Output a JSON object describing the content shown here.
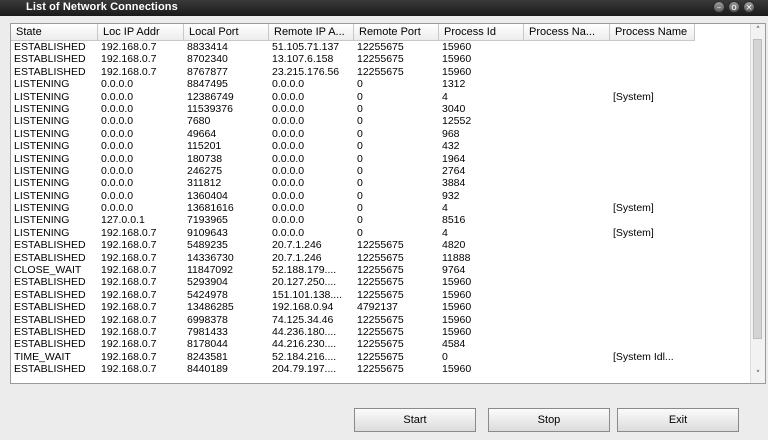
{
  "window": {
    "title": "List of Network Connections",
    "controls": {
      "minimize": "–",
      "restore": "o",
      "close": "×"
    }
  },
  "table": {
    "columns": [
      "State",
      "Loc IP Addr",
      "Local Port",
      "Remote IP A...",
      "Remote Port",
      "Process Id",
      "Process Na...",
      "Process Name"
    ],
    "rows": [
      [
        "ESTABLISHED",
        "192.168.0.7",
        "8833414",
        "51.105.71.137",
        "12255675",
        "15960",
        "",
        ""
      ],
      [
        "ESTABLISHED",
        "192.168.0.7",
        "8702340",
        "13.107.6.158",
        "12255675",
        "15960",
        "",
        ""
      ],
      [
        "ESTABLISHED",
        "192.168.0.7",
        "8767877",
        "23.215.176.56",
        "12255675",
        "15960",
        "",
        ""
      ],
      [
        "LISTENING",
        "0.0.0.0",
        "8847495",
        "0.0.0.0",
        "0",
        "1312",
        "",
        ""
      ],
      [
        "LISTENING",
        "0.0.0.0",
        "12386749",
        "0.0.0.0",
        "0",
        "4",
        "",
        "[System]"
      ],
      [
        "LISTENING",
        "0.0.0.0",
        "11539376",
        "0.0.0.0",
        "0",
        "3040",
        "",
        ""
      ],
      [
        "LISTENING",
        "0.0.0.0",
        "7680",
        "0.0.0.0",
        "0",
        "12552",
        "",
        ""
      ],
      [
        "LISTENING",
        "0.0.0.0",
        "49664",
        "0.0.0.0",
        "0",
        "968",
        "",
        ""
      ],
      [
        "LISTENING",
        "0.0.0.0",
        "115201",
        "0.0.0.0",
        "0",
        "432",
        "",
        ""
      ],
      [
        "LISTENING",
        "0.0.0.0",
        "180738",
        "0.0.0.0",
        "0",
        "1964",
        "",
        ""
      ],
      [
        "LISTENING",
        "0.0.0.0",
        "246275",
        "0.0.0.0",
        "0",
        "2764",
        "",
        ""
      ],
      [
        "LISTENING",
        "0.0.0.0",
        "311812",
        "0.0.0.0",
        "0",
        "3884",
        "",
        ""
      ],
      [
        "LISTENING",
        "0.0.0.0",
        "1360404",
        "0.0.0.0",
        "0",
        "932",
        "",
        ""
      ],
      [
        "LISTENING",
        "0.0.0.0",
        "13681616",
        "0.0.0.0",
        "0",
        "4",
        "",
        "[System]"
      ],
      [
        "LISTENING",
        "127.0.0.1",
        "7193965",
        "0.0.0.0",
        "0",
        "8516",
        "",
        ""
      ],
      [
        "LISTENING",
        "192.168.0.7",
        "9109643",
        "0.0.0.0",
        "0",
        "4",
        "",
        "[System]"
      ],
      [
        "ESTABLISHED",
        "192.168.0.7",
        "5489235",
        "20.7.1.246",
        "12255675",
        "4820",
        "",
        ""
      ],
      [
        "ESTABLISHED",
        "192.168.0.7",
        "14336730",
        "20.7.1.246",
        "12255675",
        "11888",
        "",
        ""
      ],
      [
        "CLOSE_WAIT",
        "192.168.0.7",
        "11847092",
        "52.188.179....",
        "12255675",
        "9764",
        "",
        ""
      ],
      [
        "ESTABLISHED",
        "192.168.0.7",
        "5293904",
        "20.127.250....",
        "12255675",
        "15960",
        "",
        ""
      ],
      [
        "ESTABLISHED",
        "192.168.0.7",
        "5424978",
        "151.101.138....",
        "12255675",
        "15960",
        "",
        ""
      ],
      [
        "ESTABLISHED",
        "192.168.0.7",
        "13486285",
        "192.168.0.94",
        "4792137",
        "15960",
        "",
        ""
      ],
      [
        "ESTABLISHED",
        "192.168.0.7",
        "6998378",
        "74.125.34.46",
        "12255675",
        "15960",
        "",
        ""
      ],
      [
        "ESTABLISHED",
        "192.168.0.7",
        "7981433",
        "44.236.180....",
        "12255675",
        "15960",
        "",
        ""
      ],
      [
        "ESTABLISHED",
        "192.168.0.7",
        "8178044",
        "44.216.230....",
        "12255675",
        "4584",
        "",
        ""
      ],
      [
        "TIME_WAIT",
        "192.168.0.7",
        "8243581",
        "52.184.216....",
        "12255675",
        "0",
        "",
        "[System Idl..."
      ],
      [
        "ESTABLISHED",
        "192.168.0.7",
        "8440189",
        "204.79.197....",
        "12255675",
        "15960",
        "",
        ""
      ]
    ]
  },
  "scrollbar": {
    "up": "˄",
    "down": "˅"
  },
  "buttons": {
    "start": "Start",
    "stop": "Stop",
    "exit": "Exit"
  },
  "colors": {
    "titlebar": "#1f1f1f",
    "background": "#ececec",
    "list_background": "#ffffff"
  }
}
